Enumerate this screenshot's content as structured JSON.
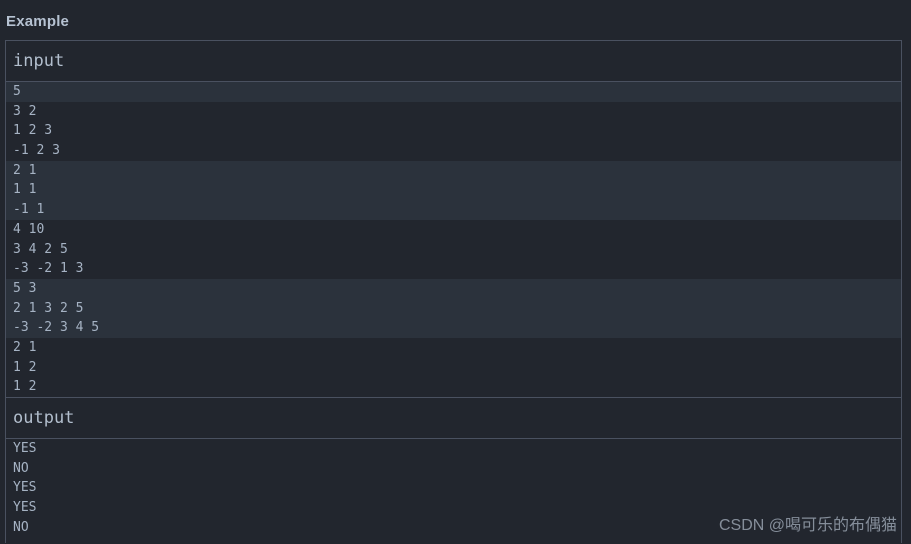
{
  "page": {
    "section_title": "Example",
    "background": "#22262e",
    "border_color": "#4a5160",
    "text_color": "#a6b3c4",
    "heading_color": "#b6c2d2",
    "stripe_color": "#2b323c"
  },
  "input": {
    "label": "input",
    "groups": [
      {
        "striped": true,
        "lines": [
          "5"
        ]
      },
      {
        "striped": false,
        "lines": [
          "3 2",
          "1 2 3",
          "-1 2 3"
        ]
      },
      {
        "striped": true,
        "lines": [
          "2 1",
          "1 1",
          "-1 1"
        ]
      },
      {
        "striped": false,
        "lines": [
          "4 10",
          "3 4 2 5",
          "-3 -2 1 3"
        ]
      },
      {
        "striped": true,
        "lines": [
          "5 3",
          "2 1 3 2 5",
          "-3 -2 3 4 5"
        ]
      },
      {
        "striped": false,
        "lines": [
          "2 1",
          "1 2",
          "1 2"
        ]
      }
    ]
  },
  "output": {
    "label": "output",
    "groups": [
      {
        "striped": false,
        "lines": [
          "YES",
          "NO",
          "YES",
          "YES",
          "NO"
        ]
      }
    ]
  },
  "watermark": {
    "text": "CSDN @喝可乐的布偶猫"
  }
}
